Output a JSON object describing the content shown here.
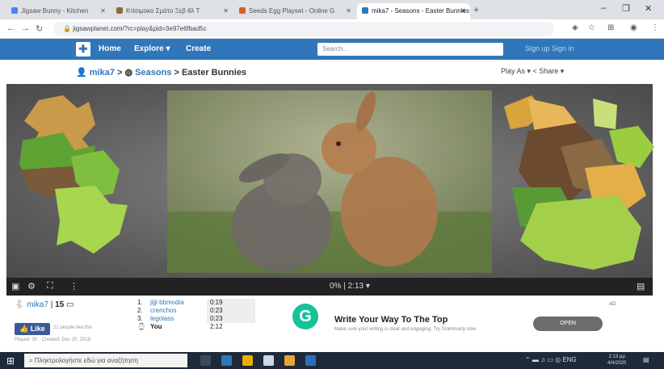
{
  "browser": {
    "tabs": [
      {
        "title": "Jigsaw Bunny - Kitchen",
        "active": false,
        "color": "#4285f4"
      },
      {
        "title": "Κτίσιμοκο Σμάτο Ξεβ θλ Τ",
        "active": false,
        "color": "#8a6d3b"
      },
      {
        "title": "Seeds Egg Playset - Online G",
        "active": false,
        "color": "#e05a2b"
      },
      {
        "title": "mika7 - Seasons - Easter Bunnies",
        "active": true,
        "color": "#2f77ba"
      }
    ],
    "new_tab": "+",
    "address": "jigsawplanet.com/?rc=play&pid=3e97e6fbad5c",
    "window_controls": [
      "–",
      "❐",
      "✕"
    ]
  },
  "site": {
    "nav": {
      "home": "Home",
      "explore": "Explore ▾",
      "create": "Create",
      "search_placeholder": "Search...",
      "signup": "Sign up  Sign in"
    },
    "breadcrumb": {
      "user": "mika7",
      "sep1": " > ",
      "category": "Seasons",
      "sep2": " > ",
      "title": "Easter Bunnies"
    },
    "play_as": "Play As ▾  < Share ▾"
  },
  "player": {
    "progress": "0%  |  2:13 ▾",
    "progress_pct": 0
  },
  "bottom": {
    "user": {
      "name": "mika7",
      "count": "15"
    },
    "like": "Like",
    "like_meta": "21 people like this",
    "fine_print": "Played: 30 · Created: Dec 20, 2018",
    "scores": [
      {
        "rank": "1.",
        "name": "jijji bbmodia",
        "time": "0:19"
      },
      {
        "rank": "2.",
        "name": "crenchos",
        "time": "0:23"
      },
      {
        "rank": "3.",
        "name": "legolass",
        "time": "0:23"
      },
      {
        "rank": "⌚",
        "name": "You",
        "time": "2:12"
      }
    ]
  },
  "ad": {
    "logo": "G",
    "title": "Write Your Way To The Top",
    "subtitle": "Make sure your writing is clear and engaging. Try Grammarly now.",
    "button": "OPEN",
    "tag": "AD"
  },
  "taskbar": {
    "search_placeholder": "Πληκτρολογήστε εδώ για αναζήτηση",
    "clock_time": "2:13 μμ",
    "clock_date": "4/4/2020"
  }
}
